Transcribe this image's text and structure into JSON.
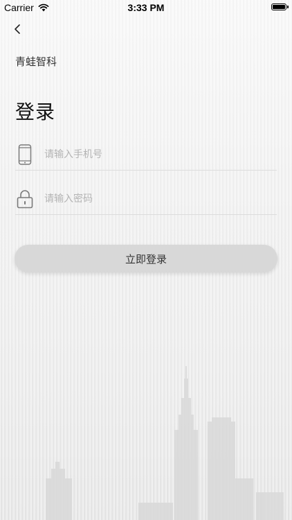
{
  "status_bar": {
    "carrier": "Carrier",
    "time": "3:33 PM"
  },
  "header": {
    "company_name": "青蛙智科"
  },
  "main": {
    "title": "登录",
    "phone_placeholder": "请输入手机号",
    "password_placeholder": "请输入密码",
    "login_label": "立即登录"
  }
}
